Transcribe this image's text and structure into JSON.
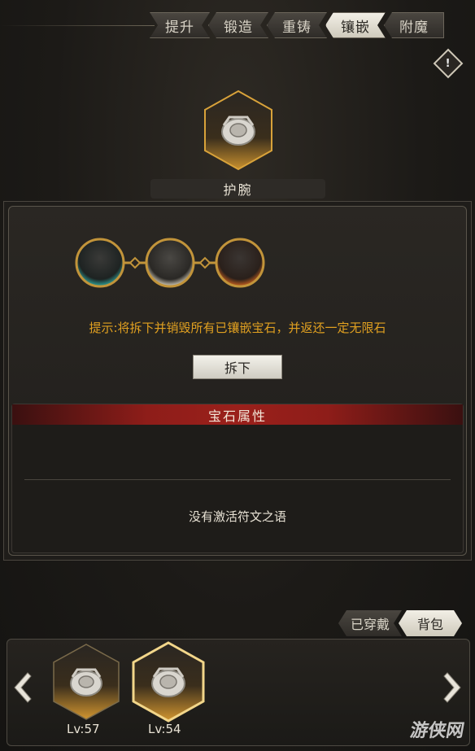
{
  "tabs": [
    {
      "label": "提升",
      "active": false
    },
    {
      "label": "锻造",
      "active": false
    },
    {
      "label": "重铸",
      "active": false
    },
    {
      "label": "镶嵌",
      "active": true
    },
    {
      "label": "附魔",
      "active": false
    }
  ],
  "info_button": {
    "icon": "exclamation-diamond-icon",
    "symbol": "!"
  },
  "equipment": {
    "name": "护腕",
    "icon": "bracer-icon"
  },
  "sockets": [
    {
      "name": "socket-teal",
      "color": "#2fa9a0"
    },
    {
      "name": "socket-white",
      "color": "#d9d2c0"
    },
    {
      "name": "socket-orange",
      "color": "#d0631f"
    }
  ],
  "hint": "提示:将拆下并销毁所有已镶嵌宝石，并返还一定无限石",
  "remove_button": "拆下",
  "gem_attributes": {
    "title": "宝石属性",
    "empty_text": "没有激活符文之语"
  },
  "inventory": {
    "tabs": [
      {
        "label": "已穿戴",
        "active": false
      },
      {
        "label": "背包",
        "active": true
      }
    ],
    "items": [
      {
        "level": "Lv:57",
        "icon": "bracer-icon",
        "selected": false
      },
      {
        "level": "Lv:54",
        "icon": "bracer-icon",
        "selected": true
      }
    ]
  },
  "watermark": "游侠网",
  "colors": {
    "accent_gold": "#d8a23a",
    "hint_orange": "#e0a020",
    "header_red": "#9a201b"
  }
}
